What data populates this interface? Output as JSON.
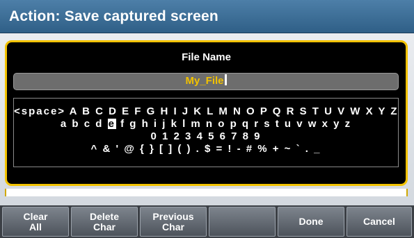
{
  "title": "Action: Save captured screen",
  "dialog": {
    "label": "File Name",
    "value": "My_File"
  },
  "keyboard": {
    "rows": [
      "<space> A B C D E F G H I J K L M N O P Q R S T U V W X Y Z",
      "a b c d e f g h i j k l m n o p q r s t u v w x y z",
      "0 1 2 3 4 5 6 7 8 9",
      "^ & ' @ { } [ ] ( ) . $ = ! - # % + ~ ` . _"
    ],
    "row2_before": "a b c d ",
    "row2_selected": "e",
    "row2_after": " f g h i j k l m n o p q r s t u v w x y z"
  },
  "softkeys": [
    {
      "label": "Clear\nAll"
    },
    {
      "label": "Delete\nChar"
    },
    {
      "label": "Previous\nChar"
    },
    {
      "label": ""
    },
    {
      "label": "Done"
    },
    {
      "label": "Cancel"
    }
  ]
}
